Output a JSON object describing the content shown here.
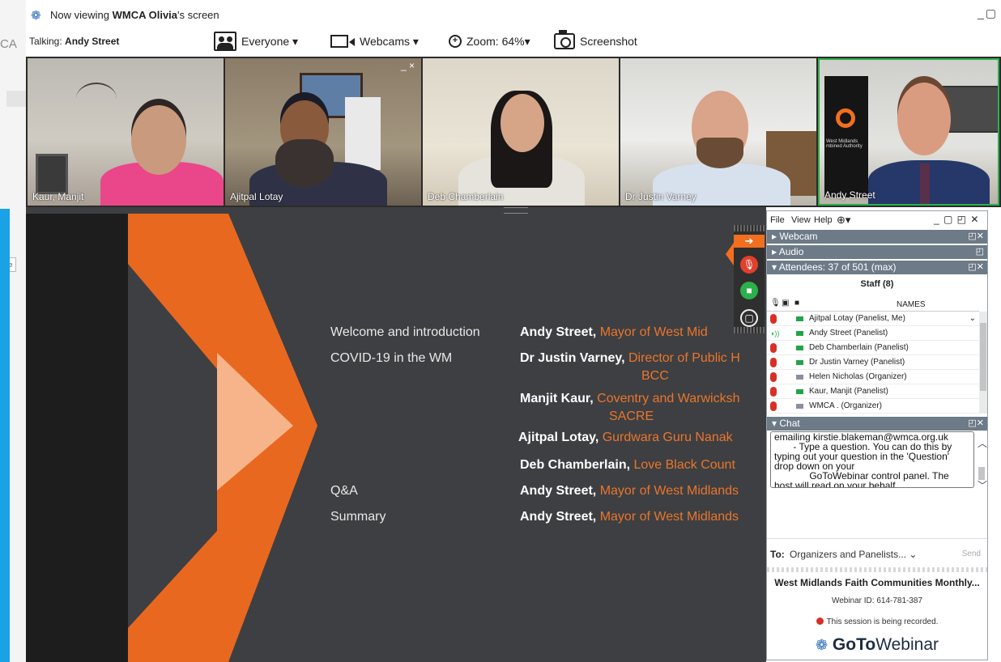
{
  "window": {
    "title_prefix": "Now viewing",
    "title_owner": "WMCA Olivia",
    "title_suffix": "'s screen"
  },
  "toolbar": {
    "talking_label": "Talking:",
    "talking_name": "Andy Street",
    "everyone_label": "Everyone ▾",
    "webcams_label": "Webcams ▾",
    "zoom_label": "Zoom: 64%▾",
    "screenshot_label": "Screenshot"
  },
  "webcams": [
    {
      "name": "Kaur, Manjit"
    },
    {
      "name": "Ajitpal Lotay"
    },
    {
      "name": "Deb Chamberlain"
    },
    {
      "name": "Dr Justin Varney"
    },
    {
      "name": "Andy Street"
    }
  ],
  "tile_close": "_ ×",
  "background_app": {
    "fragment": "CA",
    "box": "e"
  },
  "camera_text": {
    "logo_line1": "West Midlands",
    "logo_line2": "mbined Authority"
  },
  "slide": {
    "agenda": [
      {
        "item": "Welcome and introduction",
        "speaker": "Andy Street,",
        "role": " Mayor of West Mid"
      },
      {
        "item": "COVID-19 in the WM",
        "speaker": "Dr Justin Varney,",
        "role": " Director of Public H"
      },
      {
        "item": "",
        "speaker": "",
        "role": "BCC"
      },
      {
        "item": "",
        "speaker": "Manjit Kaur,",
        "role": " Coventry and Warwicksh"
      },
      {
        "item": "",
        "speaker": "",
        "role": "SACRE"
      },
      {
        "item": "",
        "speaker": "Ajitpal Lotay,",
        "role": " Gurdwara Guru Nanak"
      },
      {
        "item": "",
        "speaker": "Deb Chamberlain,",
        "role": " Love Black Count"
      },
      {
        "item": "Q&A",
        "speaker": "Andy Street,",
        "role": " Mayor of West Midlands"
      },
      {
        "item": "Summary",
        "speaker": "Andy Street,",
        "role": " Mayor of West Midlands"
      }
    ]
  },
  "panel": {
    "menu": {
      "file": "File",
      "view": "View",
      "help": "Help",
      "globe": "⊕▾",
      "controls": "_ ▢ ◰ ✕"
    },
    "sections": {
      "webcam": "Webcam",
      "audio": "Audio",
      "attendees": "Attendees: 37 of 501 (max)",
      "chat": "Chat"
    },
    "section_icons": {
      "webcam": "◰✕",
      "audio": "◰",
      "attendees": "◰✕",
      "chat": "◰✕"
    },
    "staff_header": "Staff (8)",
    "names_header": "NAMES",
    "list_chevron": "⌄",
    "attendees": [
      {
        "name": "Ajitpal Lotay (Panelist, Me)",
        "mic": "muted",
        "cam": "on"
      },
      {
        "name": "Andy Street (Panelist)",
        "mic": "talking",
        "cam": "on"
      },
      {
        "name": "Deb Chamberlain (Panelist)",
        "mic": "muted",
        "cam": "on"
      },
      {
        "name": "Dr Justin Varney (Panelist)",
        "mic": "muted",
        "cam": "on"
      },
      {
        "name": "Helen Nicholas (Organizer)",
        "mic": "muted",
        "cam": "off"
      },
      {
        "name": "Kaur, Manjit (Panelist)",
        "mic": "muted",
        "cam": "on"
      },
      {
        "name": "WMCA . (Organizer)",
        "mic": "muted",
        "cam": "off"
      }
    ],
    "chat_lines": [
      "emailing kirstie.blakeman@wmca.org.uk",
      "       - Type a question. You can do this by",
      "typing out your question in the 'Question'",
      "drop down on your",
      "             GoToWebinar control panel. The",
      "host will read on your behalf"
    ],
    "to_label": "To:",
    "to_value": "Organizers and Panelists...  ⌄",
    "send_label": "Send",
    "webinar_title": "West Midlands Faith Communities Monthly...",
    "webinar_id": "Webinar ID: 614-781-387",
    "recording_text": "This session is being recorded.",
    "brand_bold": "GoTo",
    "brand_light": "Webinar"
  },
  "colors": {
    "accent_orange": "#f26f1f",
    "panel_header": "#6d7a88",
    "slide_bg": "#3e3f42"
  }
}
